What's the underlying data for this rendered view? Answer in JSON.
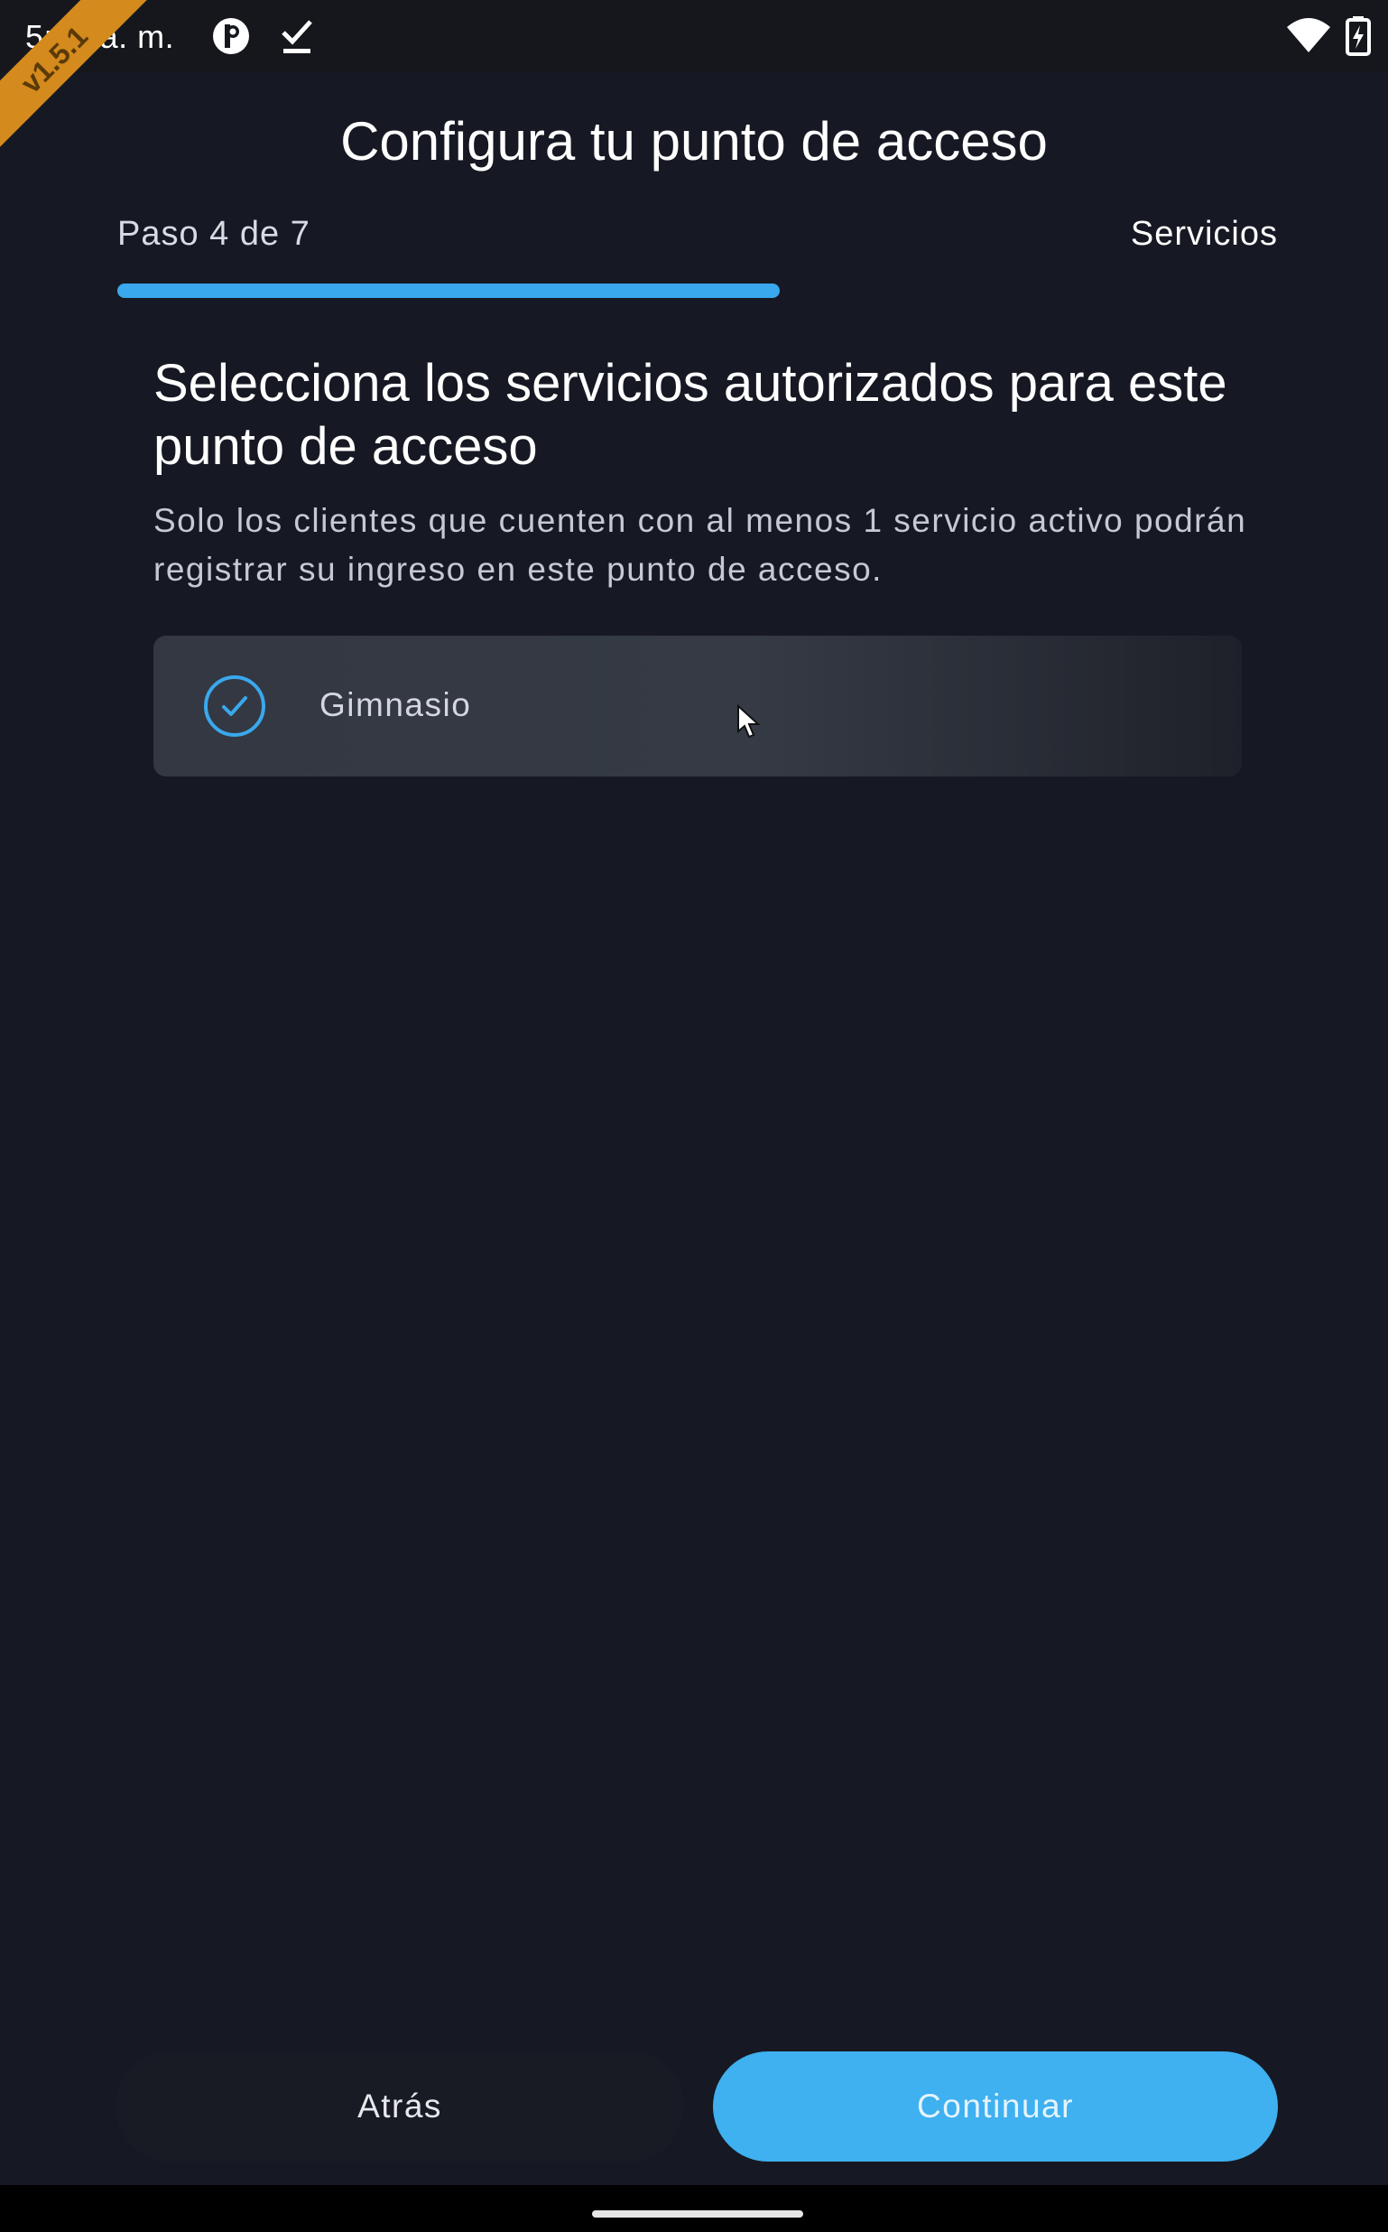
{
  "status_bar": {
    "time": "5:54 a. m.",
    "icons": [
      "app-notification-icon",
      "download-done-icon",
      "wifi-icon",
      "battery-charging-icon"
    ]
  },
  "debug_banner": {
    "text": "v1.5.1"
  },
  "app_bar": {
    "title": "Configura tu punto de acceso"
  },
  "stepper": {
    "step_label": "Paso 4 de 7",
    "step_name": "Servicios",
    "progress_fraction": 0.571,
    "accent_color": "#3aa8ec"
  },
  "content": {
    "heading": "Selecciona los servicios autorizados para este punto de acceso",
    "description": "Solo los clientes que cuenten con al menos 1 servicio activo podrán registrar su ingreso en este punto de acceso.",
    "services": [
      {
        "label": "Gimnasio",
        "selected": true,
        "icon": "check-circle-icon"
      }
    ]
  },
  "footer": {
    "back_label": "Atrás",
    "continue_label": "Continuar",
    "continue_color": "#3fb0f0"
  }
}
